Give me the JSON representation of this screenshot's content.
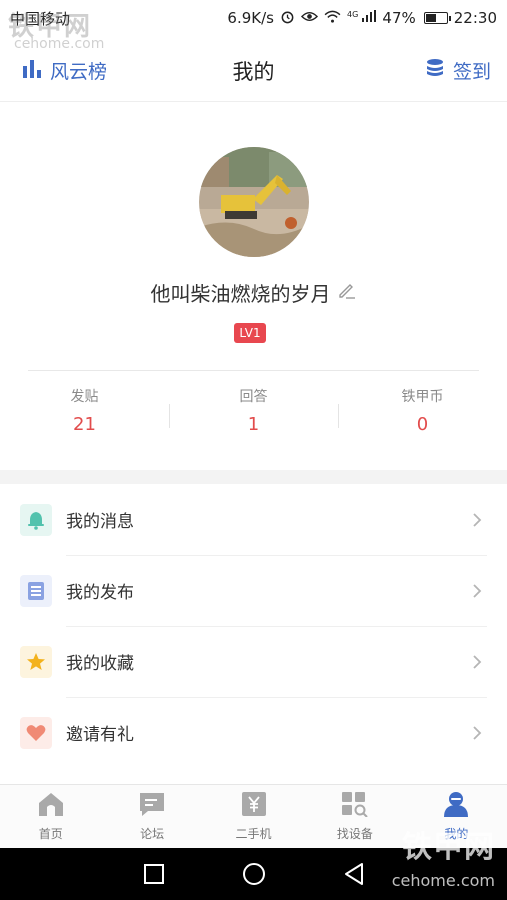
{
  "status_bar": {
    "carrier": "中国移动",
    "speed": "6.9K/s",
    "signal": "4G",
    "battery": "47%",
    "battery_level": 0.47,
    "time": "22:30"
  },
  "watermark": {
    "text": "铁甲网",
    "site": "cehome.com"
  },
  "header": {
    "left_label": "风云榜",
    "title": "我的",
    "right_label": "签到",
    "accent": "#3f6bc4"
  },
  "profile": {
    "username": "他叫柴油燃烧的岁月",
    "level": "LV1",
    "stats": [
      {
        "label": "发贴",
        "value": "21"
      },
      {
        "label": "回答",
        "value": "1"
      },
      {
        "label": "铁甲币",
        "value": "0"
      }
    ]
  },
  "menu": [
    {
      "label": "我的消息",
      "icon": "bell-icon",
      "color": "#52c2ad",
      "bg": "#e6f6f2"
    },
    {
      "label": "我的发布",
      "icon": "document-icon",
      "color": "#8aa2e2",
      "bg": "#ecf0fb"
    },
    {
      "label": "我的收藏",
      "icon": "star-icon",
      "color": "#f3b21c",
      "bg": "#fdf4de"
    },
    {
      "label": "邀请有礼",
      "icon": "heart-icon",
      "color": "#f08a75",
      "bg": "#fdece8"
    }
  ],
  "tabs": [
    {
      "label": "首页",
      "icon": "home-icon"
    },
    {
      "label": "论坛",
      "icon": "chat-icon"
    },
    {
      "label": "二手机",
      "icon": "yen-icon"
    },
    {
      "label": "找设备",
      "icon": "grid-search-icon"
    },
    {
      "label": "我的",
      "icon": "person-icon",
      "active": true
    }
  ]
}
